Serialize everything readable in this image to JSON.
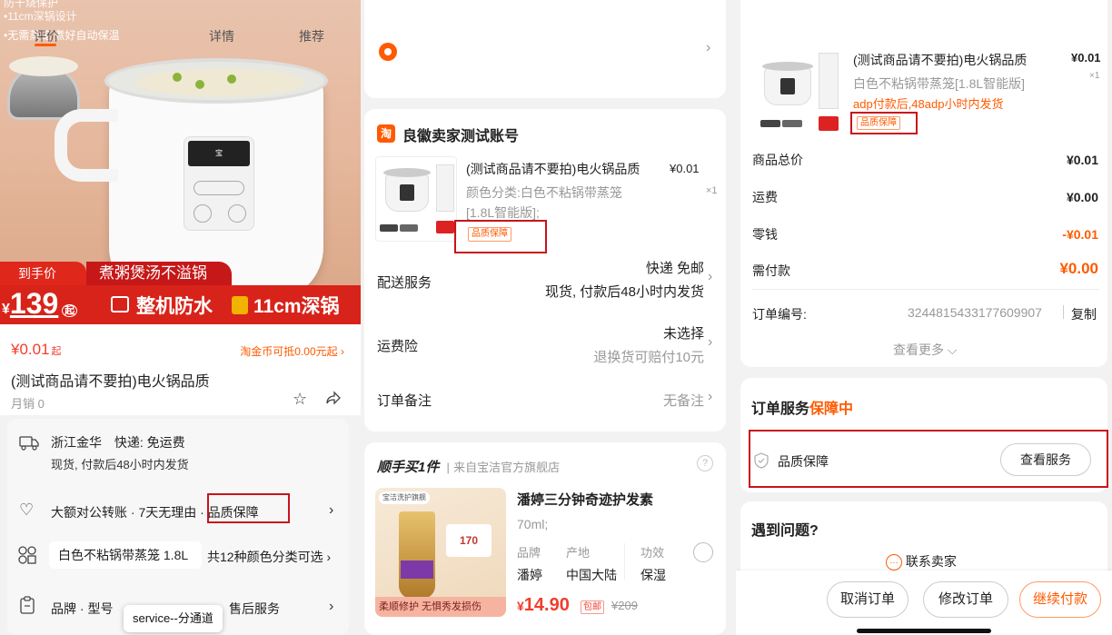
{
  "colors": {
    "accent": "#f23d2b",
    "orange": "#ff5a00",
    "highlight_box": "#c8141b"
  },
  "panel1": {
    "banner": {
      "tag1": "防干烧保护",
      "tag2": "•11cm深锅设计",
      "tag3": "•无需蒸笼 煮好自动保温",
      "nav_tabs": [
        "评价",
        "详情",
        "推荐"
      ],
      "badge_price_label": "到手价",
      "badge_slogan": "煮粥煲汤不溢锅",
      "big_price": "139",
      "big_price_prefix": "¥",
      "big_price_suffix": "起",
      "strip_text1": "整机防水",
      "strip_text2": "11cm深锅",
      "device_brand": "宝"
    },
    "price": "¥0.01",
    "price_suffix": "起",
    "coin_text": "淘金币可抵0.00元起",
    "title": "(测试商品请不要拍)电火锅品质",
    "monthly_sales": "月销 0",
    "shipping": {
      "origin": "浙江金华",
      "express": "快递: 免运费",
      "dispatch": "现货, 付款后48小时内发货"
    },
    "guarantee_row": {
      "text": "大额对公转账 · 7天无理由 · ",
      "highlight": "品质保障"
    },
    "variant_row": {
      "selected": "白色不粘锅带蒸笼 1.8L",
      "count": "共12种颜色分类可选"
    },
    "brand_row": {
      "left": "品牌 · 型号",
      "right": "售后服务"
    },
    "toast": "service--分通道"
  },
  "panel2": {
    "seller_name": "良徽卖家测试账号",
    "seller_icon": "淘",
    "product": {
      "title": "(测试商品请不要拍)电火锅品质",
      "price": "¥0.01",
      "variant": "颜色分类:白色不粘锅带蒸笼",
      "variant2": "[1.8L智能版];",
      "qty": "×1",
      "tag": "品质保障"
    },
    "delivery": {
      "label": "配送服务",
      "method": "快递 免邮",
      "note": "现货, 付款后48小时内发货"
    },
    "insurance": {
      "label": "运费险",
      "status": "未选择",
      "note": "退换货可赔付10元"
    },
    "remark": {
      "label": "订单备注",
      "value": "无备注"
    },
    "recommend": {
      "header_bold": "顺手买1件",
      "header_src": "来自宝洁官方旗舰店",
      "title": "潘婷三分钟奇迹护发素",
      "spec": "70ml;",
      "attr_labels": [
        "品牌",
        "产地",
        "功效"
      ],
      "attr_values": [
        "潘婷",
        "中国大陆",
        "保湿"
      ],
      "price": "14.90",
      "price_sym": "¥",
      "badge": "包邮",
      "orig_price": "¥209",
      "img_tag": "宝洁洗护旗舰",
      "img_caption": "柔顺修护 无惧秀发损伤",
      "img_price": "170"
    }
  },
  "panel3": {
    "product": {
      "title": "(测试商品请不要拍)电火锅品质",
      "price": "¥0.01",
      "variant": "白色不粘锅带蒸笼[1.8L智能版]",
      "qty": "×1",
      "promise": "adp付款后,48adp小时内发货",
      "tag": "品质保障"
    },
    "summary": [
      {
        "label": "商品总价",
        "value": "¥0.01"
      },
      {
        "label": "运费",
        "value": "¥0.00"
      },
      {
        "label": "零钱",
        "value": "-¥0.01"
      },
      {
        "label": "需付款",
        "value": "¥0.00"
      }
    ],
    "order_no_label": "订单编号:",
    "order_no": "3244815433177609907",
    "copy": "复制",
    "more": "查看更多",
    "service_title": "订单服务",
    "service_status": "保障中",
    "service_item": "品质保障",
    "service_btn": "查看服务",
    "problem_title": "遇到问题?",
    "contact": "联系卖家",
    "actions": [
      "取消订单",
      "修改订单",
      "继续付款"
    ]
  }
}
